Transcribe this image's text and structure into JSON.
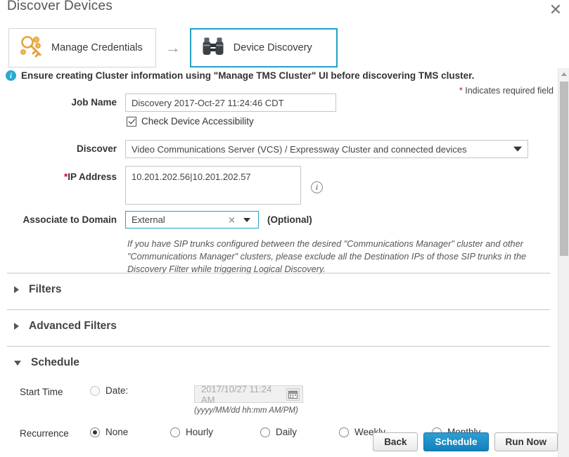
{
  "dialog": {
    "title": "Discover Devices",
    "close_icon": "close-icon"
  },
  "wizard": {
    "steps": [
      {
        "label": "Manage Credentials",
        "icon": "key-icon",
        "active": false
      },
      {
        "label": "Device Discovery",
        "icon": "binoculars-icon",
        "active": true
      }
    ],
    "separator_icon": "arrow-right-icon"
  },
  "notice": {
    "icon": "info-circle-icon",
    "text": "Ensure creating Cluster information using \"Manage TMS Cluster\" UI before discovering TMS cluster."
  },
  "required_note": {
    "star": "*",
    "text": " Indicates required field"
  },
  "form": {
    "job_name": {
      "label": "Job Name",
      "value": "Discovery 2017-Oct-27 11:24:46 CDT",
      "placeholder": ""
    },
    "check_accessibility": {
      "label": "Check Device Accessibility",
      "checked": true
    },
    "discover": {
      "label": "Discover",
      "value": "Video Communications Server (VCS) / Expressway Cluster and connected devices"
    },
    "ip_address": {
      "label": "IP Address",
      "star": "*",
      "value": "10.201.202.56|10.201.202.57",
      "placeholder": "",
      "info_icon": "info-circle-outline-icon"
    },
    "associate_domain": {
      "label": "Associate to Domain",
      "value": "External",
      "clear_icon": "clear-x-icon",
      "optional_text": "(Optional)"
    },
    "help_text": "If you have SIP trunks configured between the desired \"Communications Manager\" cluster and other \"Communications Manager\" clusters, please exclude all the Destination IPs of those SIP trunks in the Discovery Filter while triggering Logical Discovery."
  },
  "sections": [
    {
      "title": "Filters",
      "expanded": false
    },
    {
      "title": "Advanced Filters",
      "expanded": false
    },
    {
      "title": "Schedule",
      "expanded": true
    }
  ],
  "schedule": {
    "start_time": {
      "label": "Start Time",
      "date_radio_label": "Date:",
      "date_selected": false,
      "date_value": "2017/10/27 11:24 AM",
      "date_format_hint": "(yyyy/MM/dd hh:mm AM/PM)",
      "calendar_icon": "calendar-icon"
    },
    "recurrence": {
      "label": "Recurrence",
      "options": [
        {
          "label": "None",
          "selected": true
        },
        {
          "label": "Hourly",
          "selected": false
        },
        {
          "label": "Daily",
          "selected": false
        },
        {
          "label": "Weekly",
          "selected": false
        },
        {
          "label": "Monthly",
          "selected": false
        }
      ]
    }
  },
  "buttons": [
    {
      "label": "Back",
      "primary": false
    },
    {
      "label": "Schedule",
      "primary": true
    },
    {
      "label": "Run Now",
      "primary": false
    }
  ],
  "scrollbar": {
    "up_icon": "scroll-up-arrow-icon"
  },
  "colors": {
    "accent": "#23a0c8",
    "primary_button": "#1480bb",
    "required_star": "#d0021b",
    "info": "#29abd0"
  }
}
